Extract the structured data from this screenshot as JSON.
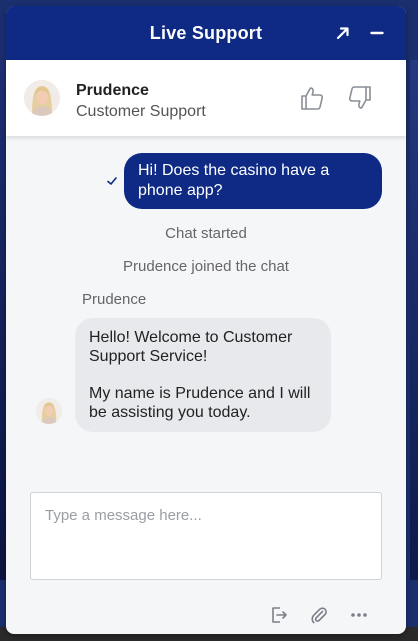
{
  "header": {
    "title": "Live Support",
    "expand_icon": "arrow-up-right-icon",
    "minimize_icon": "minus-icon",
    "background": "#0e2a84"
  },
  "agent": {
    "name": "Prudence",
    "role": "Customer Support",
    "rate_up_icon": "thumbs-up-icon",
    "rate_down_icon": "thumbs-down-icon"
  },
  "messages": {
    "sent": {
      "text": "Hi! Does the casino have a phone app?",
      "status_icon": "check-icon"
    },
    "system": [
      "Chat started",
      "Prudence joined the chat"
    ],
    "received": {
      "sender": "Prudence",
      "paragraphs": [
        "Hello! Welcome to Customer Support Service!",
        "My name is Prudence and I will be assisting you today."
      ]
    }
  },
  "composer": {
    "placeholder": "Type a message here...",
    "value": ""
  },
  "toolbar": {
    "end_chat_icon": "exit-door-icon",
    "attach_icon": "paperclip-icon",
    "more_icon": "more-dots-icon"
  },
  "colors": {
    "accent": "#0e2a84",
    "received_bubble": "#e8e9ec",
    "panel": "#f5f6f8"
  }
}
